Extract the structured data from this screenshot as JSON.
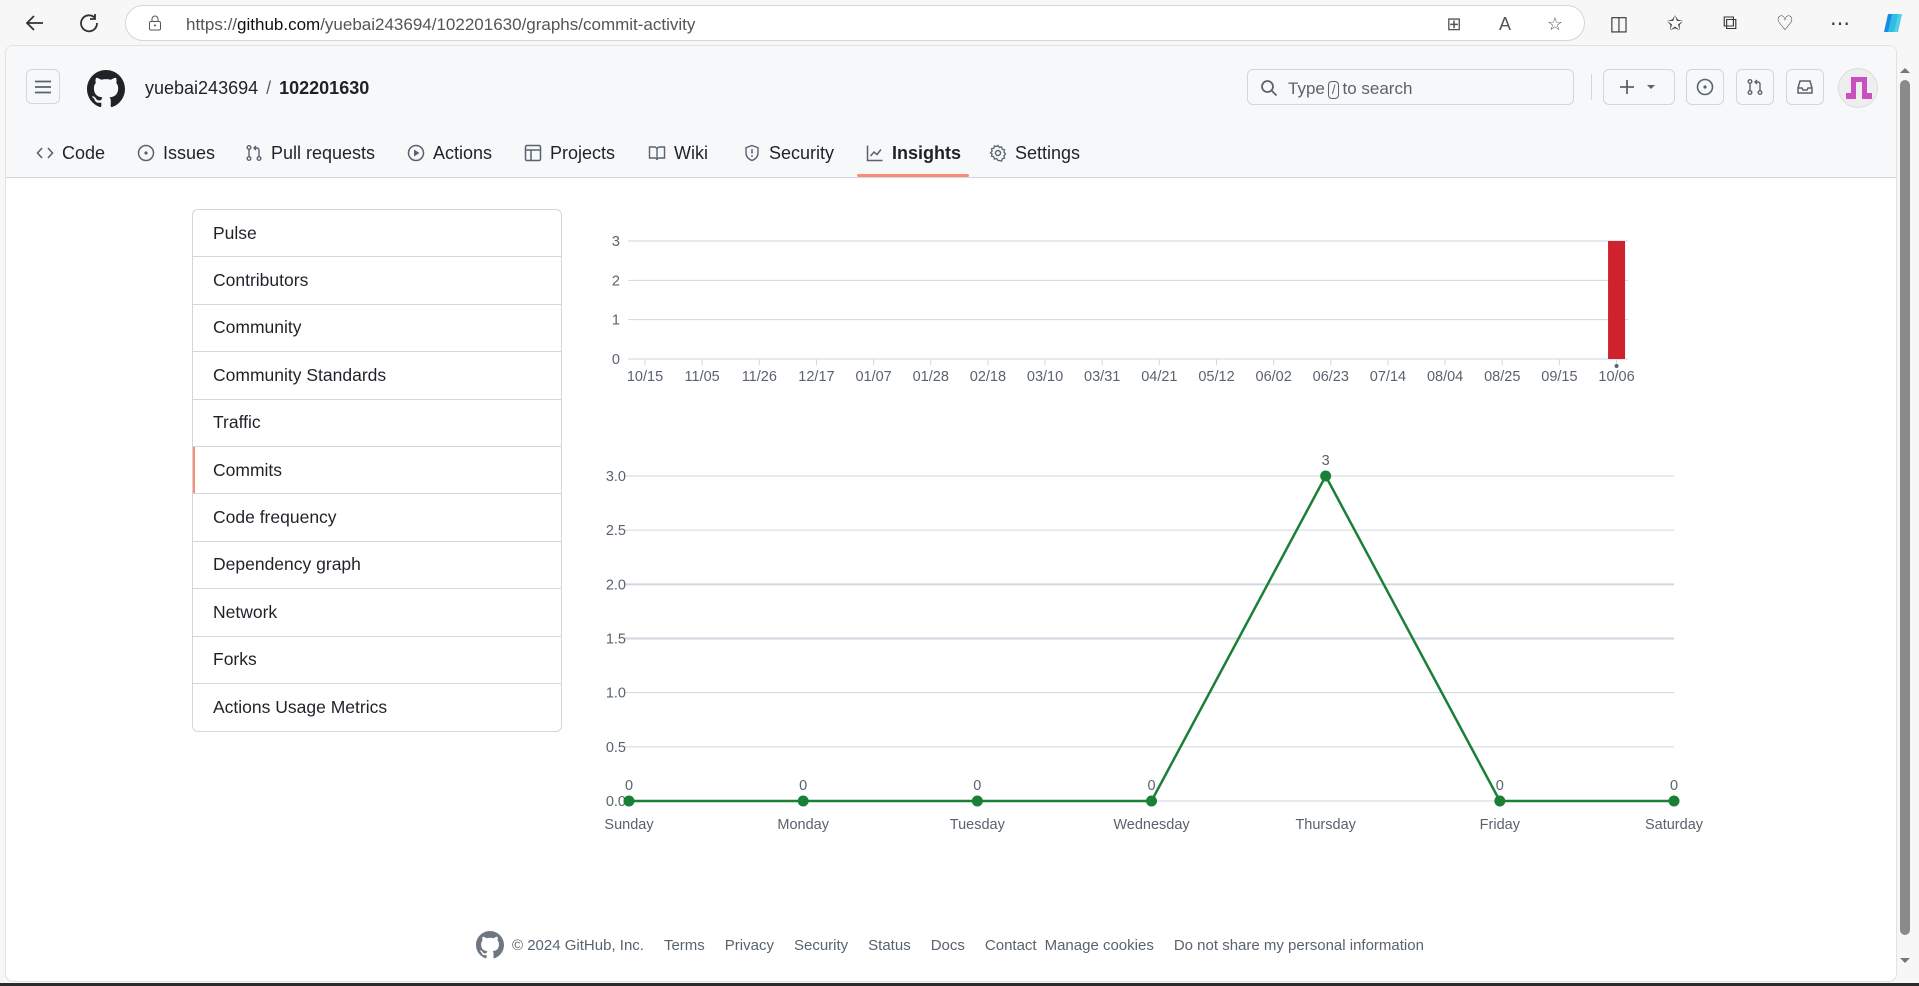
{
  "browser": {
    "url_prefix": "https://",
    "url_domain": "github.com",
    "url_path": "/yuebai243694/102201630/graphs/commit-activity"
  },
  "header": {
    "owner": "yuebai243694",
    "separator": "/",
    "repo": "102201630",
    "search_placeholder_before": "Type",
    "search_key": "/",
    "search_placeholder_after": "to search"
  },
  "tabs": [
    {
      "label": "Code",
      "icon": "code-icon"
    },
    {
      "label": "Issues",
      "icon": "issue-icon"
    },
    {
      "label": "Pull requests",
      "icon": "pull-request-icon"
    },
    {
      "label": "Actions",
      "icon": "play-icon"
    },
    {
      "label": "Projects",
      "icon": "table-icon"
    },
    {
      "label": "Wiki",
      "icon": "book-icon"
    },
    {
      "label": "Security",
      "icon": "shield-icon"
    },
    {
      "label": "Insights",
      "icon": "graph-icon",
      "active": true
    },
    {
      "label": "Settings",
      "icon": "gear-icon"
    }
  ],
  "sidebar": {
    "items": [
      {
        "label": "Pulse"
      },
      {
        "label": "Contributors"
      },
      {
        "label": "Community"
      },
      {
        "label": "Community Standards"
      },
      {
        "label": "Traffic"
      },
      {
        "label": "Commits",
        "active": true
      },
      {
        "label": "Code frequency"
      },
      {
        "label": "Dependency graph"
      },
      {
        "label": "Network"
      },
      {
        "label": "Forks"
      },
      {
        "label": "Actions Usage Metrics"
      }
    ]
  },
  "chart_data": [
    {
      "type": "bar",
      "title": "",
      "xlabel": "",
      "ylabel": "",
      "categories_tick_labels": [
        "10/15",
        "11/05",
        "11/26",
        "12/17",
        "01/07",
        "01/28",
        "02/18",
        "03/10",
        "03/31",
        "04/21",
        "05/12",
        "06/02",
        "06/23",
        "07/14",
        "08/04",
        "08/25",
        "09/15",
        "10/06"
      ],
      "weeks": 52,
      "values_nonzero": [
        {
          "week": "10/06",
          "value": 3
        }
      ],
      "note": "all other weeks are 0",
      "yticks": [
        0,
        1,
        2,
        3
      ],
      "ylim": [
        0,
        3
      ],
      "bar_color": "#cf222e",
      "grid": true
    },
    {
      "type": "line",
      "title": "",
      "categories": [
        "Sunday",
        "Monday",
        "Tuesday",
        "Wednesday",
        "Thursday",
        "Friday",
        "Saturday"
      ],
      "values": [
        0,
        0,
        0,
        0,
        3,
        0,
        0
      ],
      "yticks": [
        "0.0",
        "0.5",
        "1.0",
        "1.5",
        "2.0",
        "2.5",
        "3.0"
      ],
      "ylim": [
        0,
        3
      ],
      "line_color": "#1a7f37",
      "data_labels": true,
      "grid": true
    }
  ],
  "footer": {
    "copyright": "© 2024 GitHub, Inc.",
    "links": [
      "Terms",
      "Privacy",
      "Security",
      "Status",
      "Docs",
      "Contact",
      "Manage cookies",
      "Do not share my personal information"
    ]
  }
}
